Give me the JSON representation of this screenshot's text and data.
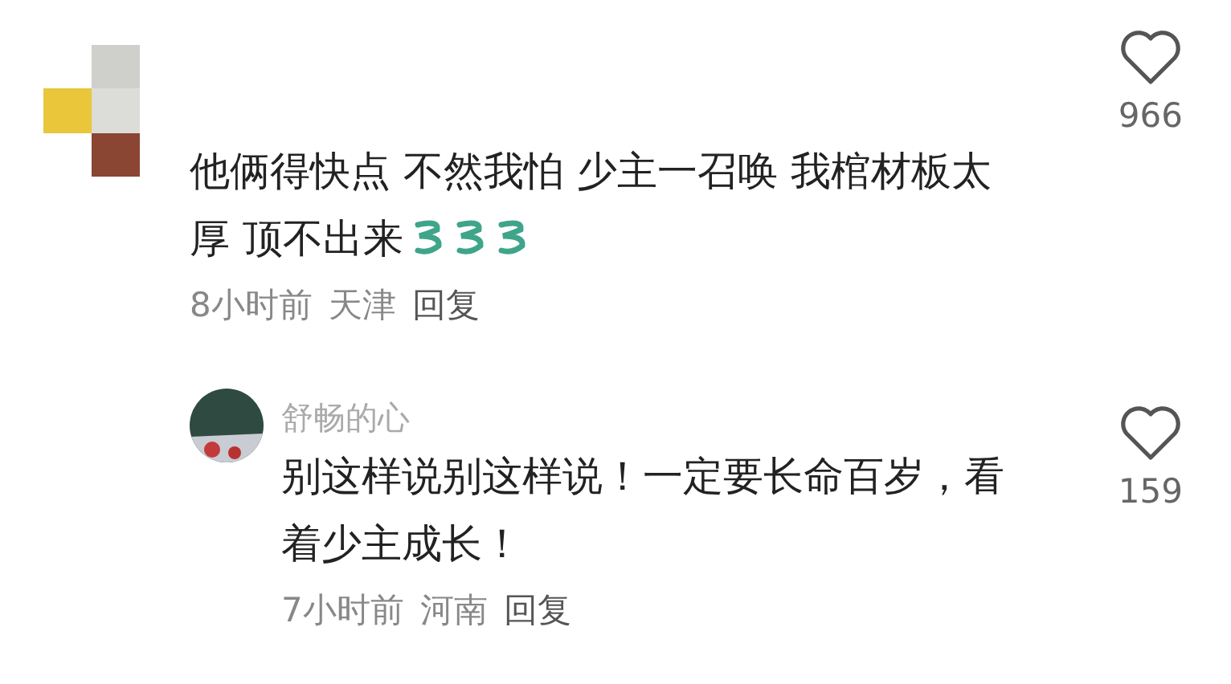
{
  "comments": [
    {
      "text": "他俩得快点 不然我怕 少主一召唤 我棺材板太厚 顶不出来",
      "stickers": [
        {
          "kind": "sticker"
        },
        {
          "kind": "sticker"
        },
        {
          "kind": "sticker"
        }
      ],
      "time": "8小时前",
      "location": "天津",
      "reply": "回复",
      "likes": "966",
      "liked": false,
      "children": [
        {
          "username": "舒畅的心",
          "text": "别这样说别这样说！一定要长命百岁，看着少主成长！",
          "time": "7小时前",
          "location": "河南",
          "reply": "回复",
          "likes": "159",
          "liked": false
        }
      ]
    }
  ]
}
